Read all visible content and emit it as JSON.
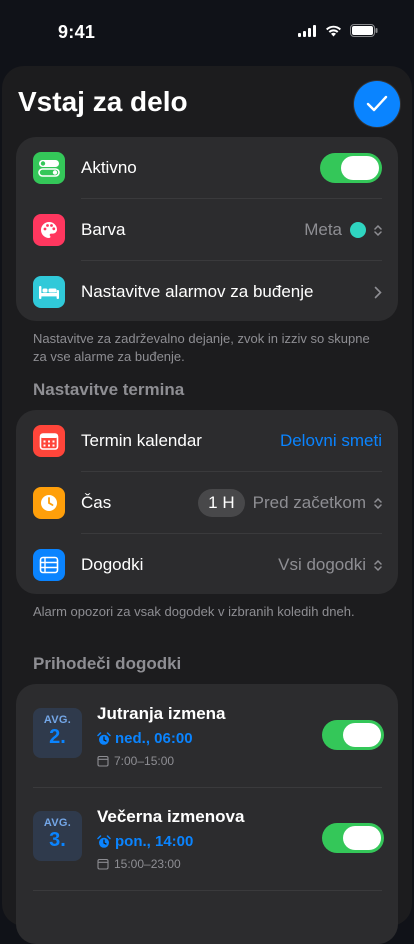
{
  "status": {
    "time": "9:41"
  },
  "header": {
    "title": "Vstaj za delo"
  },
  "main_card": {
    "active_label": "Aktivno",
    "active_on": true,
    "color_label": "Barva",
    "color_value": "Meta",
    "color_swatch": "#2fd5c0",
    "alarm_settings_label": "Nastavitve alarmov za buđenje"
  },
  "note1": "Nastavitve za zadrževalno dejanje, zvok in izziv so skupne za vse alarme za buđenje.",
  "section_term": "Nastavitve termina",
  "term_card": {
    "calendar_label": "Termin kalendar",
    "calendar_value": "Delovni smeti",
    "time_label": "Čas",
    "time_pill": "1 H",
    "time_value": "Pred začetkom",
    "events_label": "Dogodki",
    "events_value": "Vsi dogodki"
  },
  "note2": "Alarm opozori za vsak dogodek v izbranih koledih dneh.",
  "section_upcoming": "Prihodeči dogodki",
  "events": [
    {
      "month": "AVG.",
      "day": "2.",
      "title": "Jutranja izmena",
      "alarm": "ned., 06:00",
      "range": "7:00–15:00",
      "on": true
    },
    {
      "month": "AVG.",
      "day": "3.",
      "title": "Večerna izmenova",
      "alarm": "pon., 14:00",
      "range": "15:00–23:00",
      "on": true
    }
  ],
  "colors": {
    "accent": "#0a84ff",
    "toggle_on": "#34c759"
  }
}
